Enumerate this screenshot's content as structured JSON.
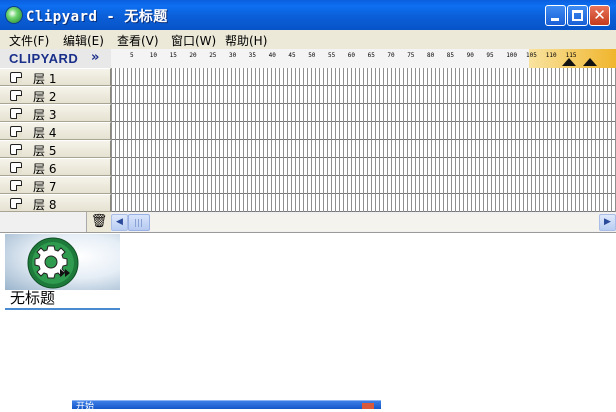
{
  "window": {
    "title": "Clipyard - 无标题",
    "close_glyph": "✕"
  },
  "menu": [
    "文件(F)",
    "编辑(E)",
    "查看(V)",
    "窗口(W)",
    "帮助(H)"
  ],
  "logo": {
    "text": "CLIPYARD",
    "chevron": "»"
  },
  "ruler": {
    "ticks": [
      "5",
      "10",
      "15",
      "20",
      "25",
      "30",
      "35",
      "40",
      "45",
      "50",
      "55",
      "60",
      "65",
      "70",
      "75",
      "80",
      "85",
      "90",
      "95",
      "100",
      "105",
      "110",
      "115"
    ]
  },
  "layers": [
    "层 1",
    "层 2",
    "层 3",
    "层 4",
    "层 5",
    "层 6",
    "层 7",
    "层 8"
  ],
  "controls": {
    "trash_glyph": "🗑",
    "scroll_left": "◀",
    "scroll_right": "▶"
  },
  "document": {
    "title": "无标题"
  },
  "taskbar": {
    "label": "开始"
  }
}
